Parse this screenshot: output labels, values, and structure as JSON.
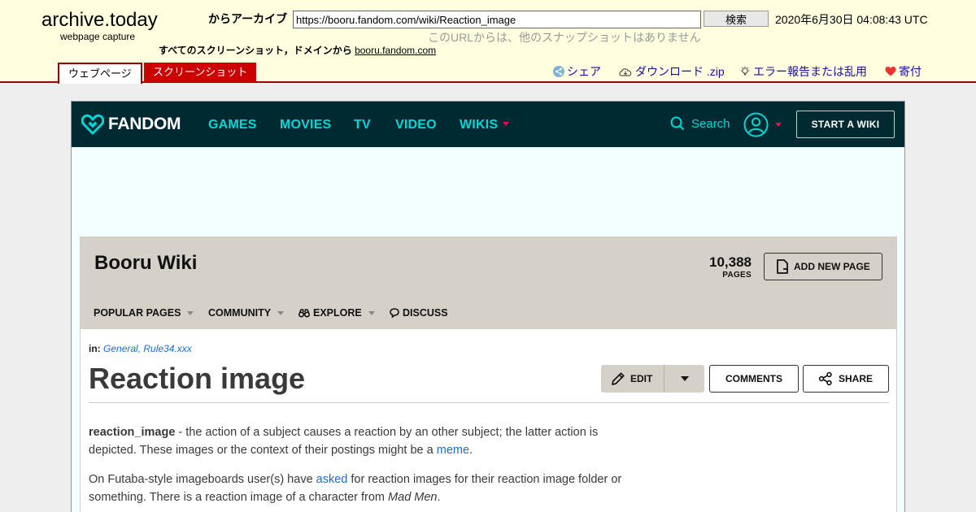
{
  "archive": {
    "brand_title": "archive.today",
    "brand_sub": "webpage capture",
    "archived_from_label": "からアーカイブ",
    "url": "https://booru.fandom.com/wiki/Reaction_image",
    "search_label": "検索",
    "capture_date": "2020年6月30日 04:08:43 UTC",
    "no_other_snapshots": "このURLからは、他のスナップショットはありません",
    "all_screenshots_label": "すべてのスクリーンショット，ドメインから",
    "domain_link": "booru.fandom.com",
    "tab_webpage": "ウェブページ",
    "tab_screenshot": "スクリーンショット",
    "share": "シェア",
    "download": "ダウンロード .zip",
    "report": "エラー報告または乱用",
    "donate": "寄付",
    "colors": {
      "header_bg": "#ffffe0",
      "accent_red": "#a10000",
      "link_blue": "#1a0dab"
    }
  },
  "fandom": {
    "logo_text": "FANDOM",
    "nav": [
      "GAMES",
      "MOVIES",
      "TV",
      "VIDEO",
      "WIKIS"
    ],
    "search_label": "Search",
    "start_wiki": "START A WIKI",
    "colors": {
      "nav_bg": "#002a32",
      "nav_link": "#00d6d6",
      "caret": "#fa005a"
    }
  },
  "wiki": {
    "name": "Booru Wiki",
    "pages_count": "10,388",
    "pages_label": "PAGES",
    "add_new_page": "ADD NEW PAGE",
    "nav": {
      "popular": "POPULAR PAGES",
      "community": "COMMUNITY",
      "explore": "EXPLORE",
      "discuss": "DISCUSS"
    }
  },
  "article": {
    "categories_label": "in:",
    "categories": "General, Rule34.xxx",
    "title": "Reaction image",
    "edit_label": "EDIT",
    "comments_label": "COMMENTS",
    "share_label": "SHARE",
    "p1_term": "reaction_image",
    "p1_text": " - the action of a subject causes a reaction by an other subject; the latter action is depicted. These images or the context of their postings might be a ",
    "p1_link": "meme",
    "p1_end": ".",
    "p2_start": "On Futaba-style imageboards user(s) have ",
    "p2_link": "asked",
    "p2_mid": " for reaction images for their reaction image folder or something. There is a reaction image of a character from ",
    "p2_italic": "Mad Men",
    "p2_end": "."
  }
}
